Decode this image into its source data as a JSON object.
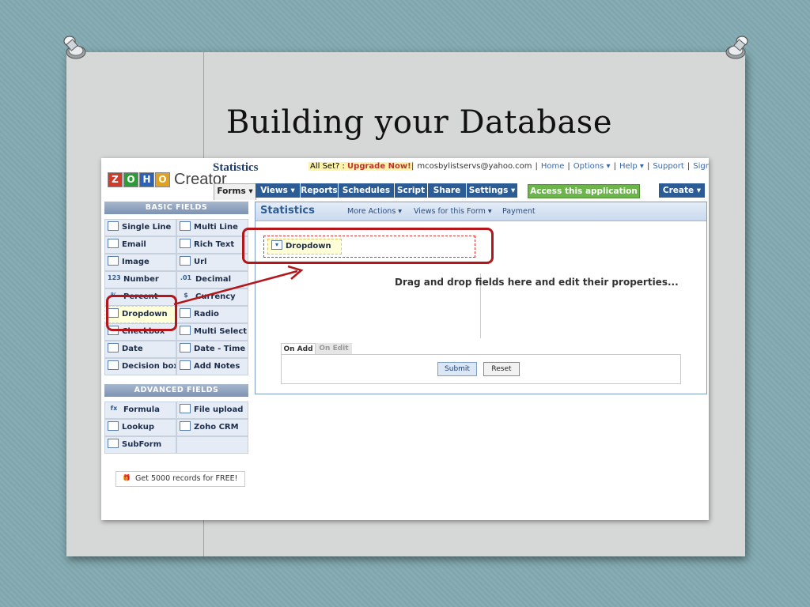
{
  "slide": {
    "title": "Building your Database"
  },
  "header": {
    "logo_letters": [
      "Z",
      "O",
      "H",
      "O"
    ],
    "logo_letter_colors": [
      "#d23a2a",
      "#2f9a3a",
      "#2c63b8",
      "#e0a020"
    ],
    "logo_word": "Creator",
    "app_title": "Statistics",
    "allset_label": "All Set? :",
    "upgrade_label": "Upgrade Now!",
    "email": "mcosbylistservs@yahoo.com",
    "links": [
      "Home",
      "Options ▾",
      "Help ▾",
      "Support",
      "Sign out"
    ]
  },
  "menu": {
    "forms_tab": "Forms ▾",
    "items": [
      "Views ▾",
      "Reports",
      "Schedules",
      "Script",
      "Share",
      "Settings ▾"
    ],
    "access": "Access this application ⊙",
    "create": "Create ▾"
  },
  "basic_fields": {
    "heading": "BASIC FIELDS",
    "items": [
      {
        "label": "Single Line",
        "icon": "single-line-icon"
      },
      {
        "label": "Multi Line",
        "icon": "multi-line-icon"
      },
      {
        "label": "Email",
        "icon": "email-icon"
      },
      {
        "label": "Rich Text",
        "icon": "rich-text-icon"
      },
      {
        "label": "Image",
        "icon": "image-icon"
      },
      {
        "label": "Url",
        "icon": "globe-icon"
      },
      {
        "label": "Number",
        "icon_text": "123"
      },
      {
        "label": "Decimal",
        "icon_text": ".01"
      },
      {
        "label": "Percent",
        "icon_text": "%"
      },
      {
        "label": "Currency",
        "icon_text": "$"
      },
      {
        "label": "Dropdown",
        "icon": "dropdown-icon"
      },
      {
        "label": "Radio",
        "icon": "radio-icon"
      },
      {
        "label": "Checkbox",
        "icon": "checkbox-icon"
      },
      {
        "label": "Multi Select",
        "icon": "multi-select-icon"
      },
      {
        "label": "Date",
        "icon": "calendar-icon"
      },
      {
        "label": "Date - Time",
        "icon": "clock-icon"
      },
      {
        "label": "Decision box",
        "icon": "decision-box-icon"
      },
      {
        "label": "Add Notes",
        "icon": "notes-icon"
      }
    ]
  },
  "advanced_fields": {
    "heading": "ADVANCED FIELDS",
    "items": [
      {
        "label": "Formula",
        "icon_text": "fx"
      },
      {
        "label": "File upload",
        "icon": "file-upload-icon"
      },
      {
        "label": "Lookup",
        "icon": "lookup-icon"
      },
      {
        "label": "Zoho CRM",
        "icon": "crm-icon"
      },
      {
        "label": "SubForm",
        "icon": "subform-icon"
      },
      {
        "label": "",
        "icon": ""
      }
    ]
  },
  "promo": "Get 5000 records for FREE!",
  "main": {
    "title": "Statistics",
    "subnav": [
      "More Actions ▾",
      "Views for this Form ▾",
      "Payment"
    ],
    "dropped_field": "Dropdown",
    "placeholder": "Drag and drop fields here and edit their properties...",
    "tabs": [
      "On Add",
      "On Edit"
    ],
    "submit": "Submit",
    "reset": "Reset"
  },
  "colors": {
    "highlight": "#b3171c",
    "menu": "#2c5c95",
    "access": "#6bb54a"
  }
}
